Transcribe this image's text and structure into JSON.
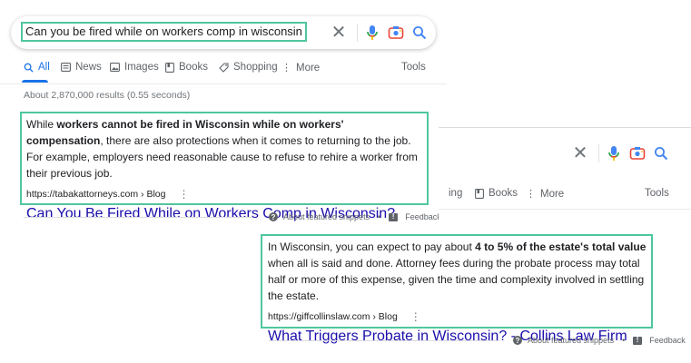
{
  "search": {
    "query": "Can you be fired while on workers comp in wisconsin"
  },
  "tabs": [
    {
      "label": "All",
      "icon": "search-icon",
      "active": true
    },
    {
      "label": "News",
      "icon": "news-icon"
    },
    {
      "label": "Images",
      "icon": "image-icon"
    },
    {
      "label": "Books",
      "icon": "book-icon"
    },
    {
      "label": "Shopping",
      "icon": "tag-icon"
    },
    {
      "label": "More",
      "icon": "more-vertical-icon"
    }
  ],
  "tools_label": "Tools",
  "result_stats": "About 2,870,000 results (0.55 seconds)",
  "snippet1": {
    "text_1": "While ",
    "bold": "workers cannot be fired in Wisconsin while on workers' compensation",
    "text_2": ", there are also protections when it comes to returning to the job. For example, employers need reasonable cause to refuse to rehire a worker from their previous job.",
    "cite": "https://tabakattorneys.com › Blog",
    "title": "Can You Be Fired While on Workers Comp in Wisconsin?"
  },
  "snippet2": {
    "text_1": "In Wisconsin, you can expect to pay about ",
    "bold": "4 to 5% of the estate's total value",
    "text_2": " when all is said and done. Attorney fees during the probate process may total half or more of this expense, given the time and complexity involved in settling the estate.",
    "cite": "https://giffcollinslaw.com › Blog",
    "title": "What Triggers Probate in Wisconsin? - Collins Law Firm"
  },
  "back_panel": {
    "tab_partial": "ing",
    "books_label": "Books",
    "more_label": "More",
    "tools_label": "Tools"
  },
  "footer": {
    "about_label": "About featured snippets",
    "separator": "•",
    "feedback_label": "Feedback"
  },
  "colors": {
    "highlight_border": "#4fc79d",
    "link": "#1a0dab",
    "accent_blue": "#1a73e8"
  }
}
